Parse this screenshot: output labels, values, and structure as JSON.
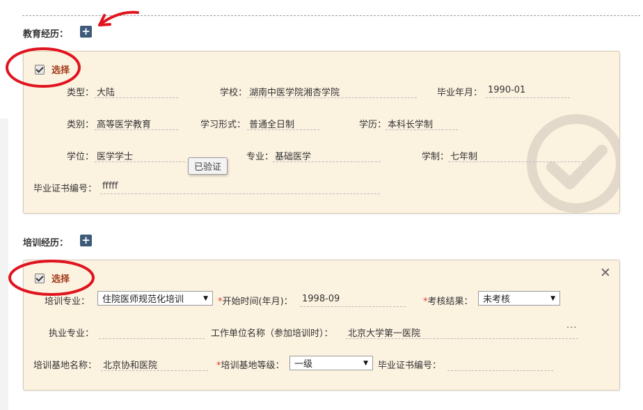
{
  "edu": {
    "title": "教育经历：",
    "add": "+",
    "select": "选择",
    "type_label": "类型：",
    "type_value": "大陆",
    "school_label": "学校：",
    "school_value": "湖南中医学院湘杏学院",
    "grad_label": "毕业年月：",
    "grad_value": "1990-01",
    "category_label": "类别：",
    "category_value": "高等医学教育",
    "study_label": "学习形式：",
    "study_value": "普通全日制",
    "record_label": "学历：",
    "record_value": "本科长学制",
    "degree_label": "学位：",
    "degree_value": "医学学士",
    "verified": "已验证",
    "major_label": "专业：",
    "major_value": "基础医学",
    "length_label": "学制：",
    "length_value": "七年制",
    "cert_label": "毕业证书编号：",
    "cert_value": "fffff"
  },
  "train": {
    "title": "培训经历：",
    "add": "+",
    "select": "选择",
    "close": "✕",
    "major_label": "培训专业：",
    "major_value": "住院医师规范化培训",
    "star": "*",
    "start_label": "开始时间(年月)：",
    "start_value": "1998-09",
    "assess_label": "考核结果：",
    "assess_value": "未考核",
    "practice_label": "执业专业：",
    "practice_value": "",
    "employer_label": "工作单位名称（参加培训时）：",
    "employer_value": "北京大学第一医院",
    "more": "···",
    "base_label": "培训基地名称：",
    "base_value": "北京协和医院",
    "level_label": "培训基地等级：",
    "level_value": "一级",
    "cert_label": "毕业证书编号：",
    "cert_value": ""
  },
  "colors": {
    "accent_red": "#e0141e",
    "card_bg": "#fcf2e0",
    "button_blue": "#3d5a78"
  }
}
